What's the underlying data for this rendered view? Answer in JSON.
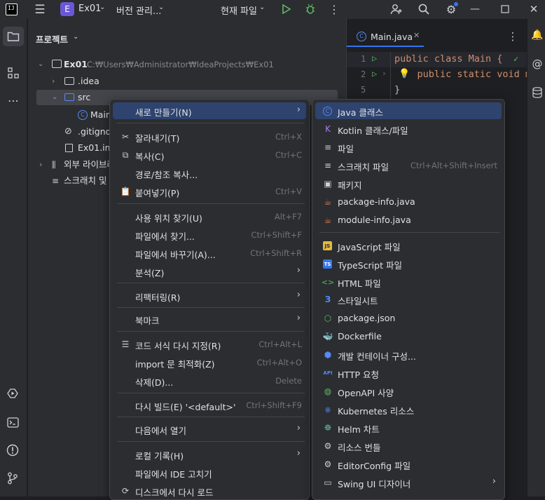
{
  "titlebar": {
    "project_badge": "E",
    "project_name": "Ex01",
    "vcs_label": "버전 관리...",
    "run_config": "현재 파일"
  },
  "project_panel": {
    "title": "프로젝트",
    "tree": [
      {
        "label": "Ex01",
        "path": "C:₩Users₩Administrator₩IdeaProjects₩Ex01"
      },
      {
        "label": ".idea"
      },
      {
        "label": "src"
      },
      {
        "label": "Main"
      },
      {
        "label": ".gitignore"
      },
      {
        "label": "Ex01.iml"
      },
      {
        "label": "외부 라이브러리"
      },
      {
        "label": "스크래치 및 콘솔"
      }
    ]
  },
  "editor": {
    "tab_label": "Main.java",
    "lines": [
      {
        "num": "1",
        "code": "public class Main {"
      },
      {
        "num": "2",
        "code": "    public static void main"
      },
      {
        "num": "5",
        "code": "}"
      }
    ]
  },
  "context_menu": {
    "items": [
      {
        "label": "새로 만들기(N)",
        "shortcut": "",
        "submenu": true,
        "icon": "none",
        "selected": true
      },
      {
        "label": "잘라내기(T)",
        "shortcut": "Ctrl+X",
        "icon": "scissors-icon"
      },
      {
        "label": "복사(C)",
        "shortcut": "Ctrl+C",
        "icon": "copy-icon"
      },
      {
        "label": "경로/참조 복사...",
        "shortcut": "",
        "icon": "none"
      },
      {
        "label": "붙여넣기(P)",
        "shortcut": "Ctrl+V",
        "icon": "paste-icon"
      },
      {
        "label": "사용 위치 찾기(U)",
        "shortcut": "Alt+F7",
        "icon": "none"
      },
      {
        "label": "파일에서 찾기...",
        "shortcut": "Ctrl+Shift+F",
        "icon": "none"
      },
      {
        "label": "파일에서 바꾸기(A)...",
        "shortcut": "Ctrl+Shift+R",
        "icon": "none"
      },
      {
        "label": "분석(Z)",
        "shortcut": "",
        "submenu": true,
        "icon": "none"
      },
      {
        "label": "리팩터링(R)",
        "shortcut": "",
        "submenu": true,
        "icon": "none"
      },
      {
        "label": "북마크",
        "shortcut": "",
        "submenu": true,
        "icon": "none"
      },
      {
        "label": "코드 서식 다시 지정(R)",
        "shortcut": "Ctrl+Alt+L",
        "icon": "reformat-icon"
      },
      {
        "label": "import 문 최적화(Z)",
        "shortcut": "Ctrl+Alt+O",
        "icon": "none"
      },
      {
        "label": "삭제(D)...",
        "shortcut": "Delete",
        "icon": "none"
      },
      {
        "label": "다시 빌드(E) '<default>'",
        "shortcut": "Ctrl+Shift+F9",
        "icon": "none"
      },
      {
        "label": "다음에서 열기",
        "shortcut": "",
        "submenu": true,
        "icon": "none"
      },
      {
        "label": "로컬 기록(H)",
        "shortcut": "",
        "submenu": true,
        "icon": "none"
      },
      {
        "label": "파일에서 IDE 고치기",
        "shortcut": "",
        "icon": "none"
      },
      {
        "label": "디스크에서 다시 로드",
        "shortcut": "",
        "icon": "reload-icon"
      }
    ]
  },
  "submenu": {
    "items": [
      {
        "label": "Java 클래스",
        "icon": "java-class-icon",
        "selected": true
      },
      {
        "label": "Kotlin 클래스/파일",
        "icon": "kotlin-icon"
      },
      {
        "label": "파일",
        "icon": "file-icon"
      },
      {
        "label": "스크래치 파일",
        "icon": "scratch-icon",
        "shortcut": "Ctrl+Alt+Shift+Insert"
      },
      {
        "label": "패키지",
        "icon": "package-icon"
      },
      {
        "label": "package-info.java",
        "icon": "java-coffee-icon"
      },
      {
        "label": "module-info.java",
        "icon": "java-coffee-icon"
      },
      {
        "label": "JavaScript 파일",
        "icon": "javascript-icon"
      },
      {
        "label": "TypeScript 파일",
        "icon": "typescript-icon"
      },
      {
        "label": "HTML 파일",
        "icon": "html-icon"
      },
      {
        "label": "스타일시트",
        "icon": "css-icon"
      },
      {
        "label": "package.json",
        "icon": "nodejs-icon"
      },
      {
        "label": "Dockerfile",
        "icon": "docker-icon"
      },
      {
        "label": "개발 컨테이너 구성...",
        "icon": "container-icon"
      },
      {
        "label": "HTTP 요청",
        "icon": "api-icon"
      },
      {
        "label": "OpenAPI 사양",
        "icon": "openapi-icon"
      },
      {
        "label": "Kubernetes 리소스",
        "icon": "kubernetes-icon"
      },
      {
        "label": "Helm 차트",
        "icon": "helm-icon"
      },
      {
        "label": "리소스 번들",
        "icon": "bundle-icon"
      },
      {
        "label": "EditorConfig 파일",
        "icon": "editorconfig-icon"
      },
      {
        "label": "Swing UI 디자이너",
        "icon": "swing-icon",
        "submenu": true
      }
    ]
  },
  "colors": {
    "accent": "#3574f0",
    "selection": "#2e436e",
    "keyword": "#cf8e6d",
    "run_green": "#5fb865"
  }
}
